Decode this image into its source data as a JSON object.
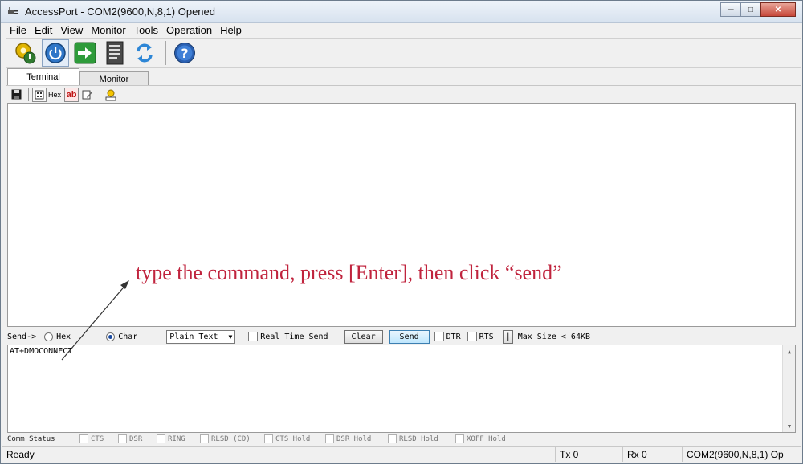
{
  "window": {
    "title": "AccessPort - COM2(9600,N,8,1) Opened",
    "app_icon": "plug-icon",
    "controls": [
      "minimize",
      "maximize",
      "close"
    ]
  },
  "menu": [
    "File",
    "Edit",
    "View",
    "Monitor",
    "Tools",
    "Operation",
    "Help"
  ],
  "toolbar": {
    "buttons": [
      {
        "name": "settings-gear-icon",
        "pressed": false
      },
      {
        "name": "power-icon",
        "pressed": true
      },
      {
        "name": "green-arrow-icon",
        "pressed": false
      },
      {
        "name": "document-icon",
        "pressed": false
      },
      {
        "name": "refresh-arrows-icon",
        "pressed": false
      },
      {
        "name": "help-icon",
        "pressed": false
      }
    ]
  },
  "tabs": [
    {
      "label": "Terminal",
      "active": true
    },
    {
      "label": "Monitor",
      "active": false
    }
  ],
  "subtoolbar": {
    "hex_label": "Hex",
    "ab_label": "ab"
  },
  "annotation": {
    "text": "type the command, press [Enter], then click “send”",
    "color": "#c0233d"
  },
  "send_row": {
    "send_label": "Send->",
    "hex_option": "Hex",
    "char_option": "Char",
    "selected_mode": "Char",
    "format_value": "Plain Text",
    "real_time_label": "Real Time Send",
    "clear_label": "Clear",
    "send_button": "Send",
    "dtr_label": "DTR",
    "rts_label": "RTS",
    "max_size_label": "Max Size < 64KB"
  },
  "send_input": {
    "value": "AT+DMOCONNECT"
  },
  "comm_status": {
    "label": "Comm Status",
    "items": [
      "CTS",
      "DSR",
      "RING",
      "RLSD (CD)",
      "CTS Hold",
      "DSR Hold",
      "RLSD Hold",
      "XOFF Hold"
    ]
  },
  "statusbar": {
    "ready": "Ready",
    "tx": "Tx 0",
    "rx": "Rx 0",
    "port": "COM2(9600,N,8,1) Op"
  }
}
